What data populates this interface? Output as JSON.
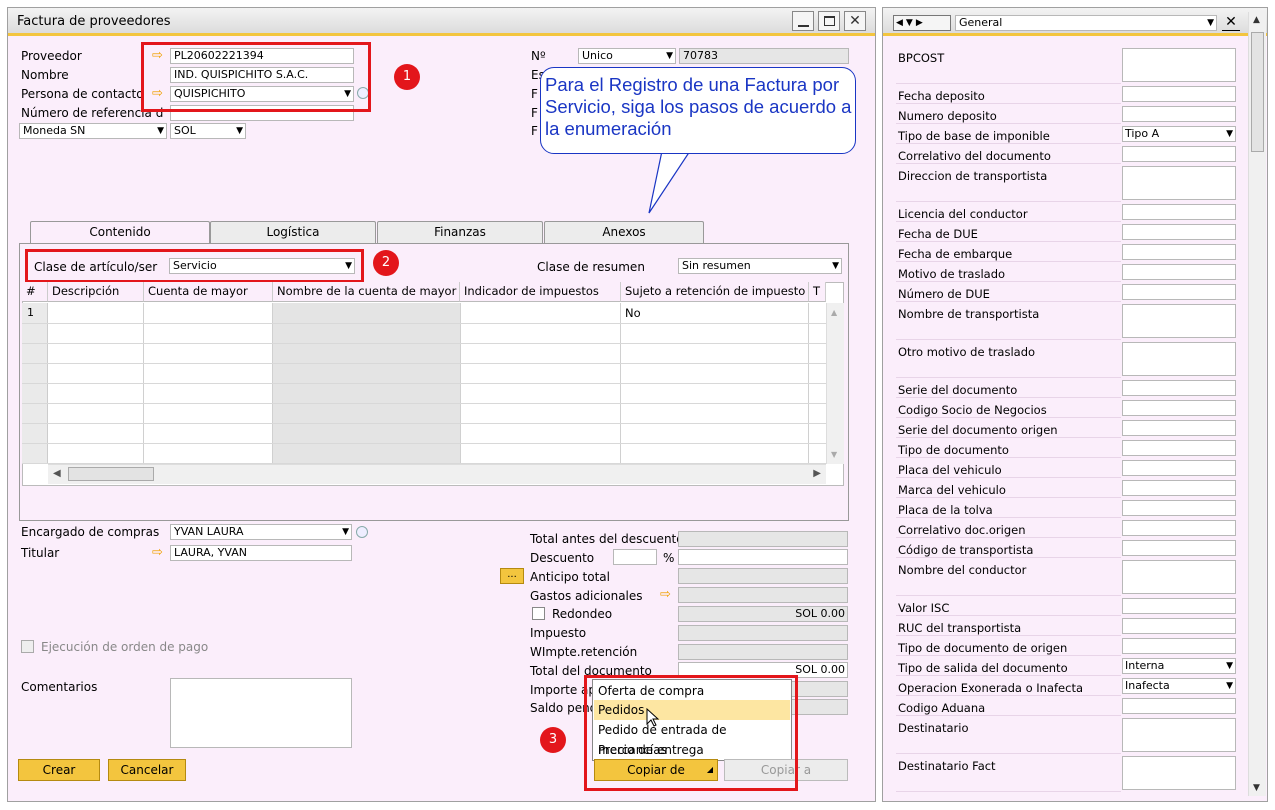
{
  "window": {
    "title": "Factura de proveedores",
    "controls": [
      "minimize-icon",
      "maximize-icon",
      "close-icon"
    ]
  },
  "header_left": {
    "proveedor_label": "Proveedor",
    "proveedor_value": "PL20602221394",
    "nombre_label": "Nombre",
    "nombre_value": "IND. QUISPICHITO S.A.C.",
    "contacto_label": "Persona de contacto",
    "contacto_value": "QUISPICHITO",
    "referencia_label": "Número de referencia d",
    "referencia_value": "",
    "moneda_label": "Moneda SN",
    "moneda_value": "SOL"
  },
  "header_right": {
    "no_label": "Nº",
    "serie_value": "Unico",
    "numero_value": "70783",
    "hidden_labels": [
      "Es",
      "F",
      "F",
      "F"
    ]
  },
  "callout": {
    "text": "Para el Registro de una Factura por Servicio, siga los pasos de acuerdo a la enumeración"
  },
  "steps": [
    "1",
    "2",
    "3"
  ],
  "tabs": [
    {
      "label": "Contenido"
    },
    {
      "label": "Logística"
    },
    {
      "label": "Finanzas"
    },
    {
      "label": "Anexos"
    }
  ],
  "content": {
    "clase_label": "Clase de artículo/ser",
    "clase_value": "Servicio",
    "resumen_label": "Clase de resumen",
    "resumen_value": "Sin resumen",
    "columns": [
      "#",
      "Descripción",
      "Cuenta de mayor",
      "Nombre de la cuenta de mayor",
      "Indicador de impuestos",
      "Sujeto a retención de impuesto",
      "T"
    ],
    "rows": [
      {
        "n": "1",
        "sujeto": "No"
      }
    ]
  },
  "footer_left": {
    "encargado_label": "Encargado de compras",
    "encargado_value": "YVAN LAURA",
    "titular_label": "Titular",
    "titular_value": "LAURA, YVAN",
    "ejecucion_label": "Ejecución de orden de pago",
    "comentarios_label": "Comentarios"
  },
  "totals": {
    "total_antes_label": "Total antes del descuento",
    "descuento_label": "Descuento",
    "percent_sign": "%",
    "anticipo_label": "Anticipo total",
    "gastos_label": "Gastos adicionales",
    "redondeo_label": "Redondeo",
    "redondeo_value": "SOL 0.00",
    "impuesto_label": "Impuesto",
    "wimpte_label": "WImpte.retención",
    "total_doc_label": "Total del documento",
    "total_doc_value": "SOL 0.00",
    "importe_label": "Importe ap",
    "saldo_label": "Saldo pend",
    "ellipsis": "..."
  },
  "copy_menu": {
    "items": [
      "Oferta de compra",
      "Pedidos",
      "Pedido de entrada de mercancías",
      "Precio de entrega"
    ],
    "highlighted": "Pedidos"
  },
  "buttons": {
    "crear": "Crear",
    "cancelar": "Cancelar",
    "copiar_de": "Copiar de",
    "copiar_a": "Copiar a"
  },
  "right_panel": {
    "selector_value": "General",
    "fields": [
      {
        "label": "BPCOST",
        "value": ""
      },
      {
        "label": "Fecha deposito",
        "value": ""
      },
      {
        "label": "Numero deposito",
        "value": ""
      },
      {
        "label": "Tipo de base de imponible",
        "value": "Tipo A"
      },
      {
        "label": "Correlativo del documento",
        "value": ""
      },
      {
        "label": "Direccion de transportista",
        "value": ""
      },
      {
        "label": "Licencia del conductor",
        "value": ""
      },
      {
        "label": "Fecha de DUE",
        "value": ""
      },
      {
        "label": "Fecha de embarque",
        "value": ""
      },
      {
        "label": "Motivo de traslado",
        "value": ""
      },
      {
        "label": "Número de DUE",
        "value": ""
      },
      {
        "label": "Nombre de transportista",
        "value": ""
      },
      {
        "label": "Otro motivo de traslado",
        "value": ""
      },
      {
        "label": "Serie del documento",
        "value": ""
      },
      {
        "label": "Codigo Socio de Negocios",
        "value": ""
      },
      {
        "label": "Serie del documento origen",
        "value": ""
      },
      {
        "label": "Tipo de documento",
        "value": ""
      },
      {
        "label": "Placa del vehiculo",
        "value": ""
      },
      {
        "label": "Marca del vehiculo",
        "value": ""
      },
      {
        "label": "Placa de la tolva",
        "value": ""
      },
      {
        "label": "Correlativo doc.origen",
        "value": ""
      },
      {
        "label": "Código de transportista",
        "value": ""
      },
      {
        "label": "Nombre del conductor",
        "value": ""
      },
      {
        "label": "Valor ISC",
        "value": ""
      },
      {
        "label": "RUC del transportista",
        "value": ""
      },
      {
        "label": "Tipo de documento de origen",
        "value": ""
      },
      {
        "label": "Tipo de salida del documento",
        "value": "Interna"
      },
      {
        "label": "Operacion Exonerada o Inafecta",
        "value": "Inafecta"
      },
      {
        "label": "Codigo Aduana",
        "value": ""
      },
      {
        "label": "Destinatario",
        "value": ""
      },
      {
        "label": "Destinatario Fact",
        "value": ""
      }
    ]
  },
  "colors": {
    "form_bg": "#fbeefb",
    "title_bar": "#e8e8e8",
    "accent": "#f3c53e",
    "annotation_red": "#e3161b",
    "callout_blue": "#1a36c4"
  }
}
